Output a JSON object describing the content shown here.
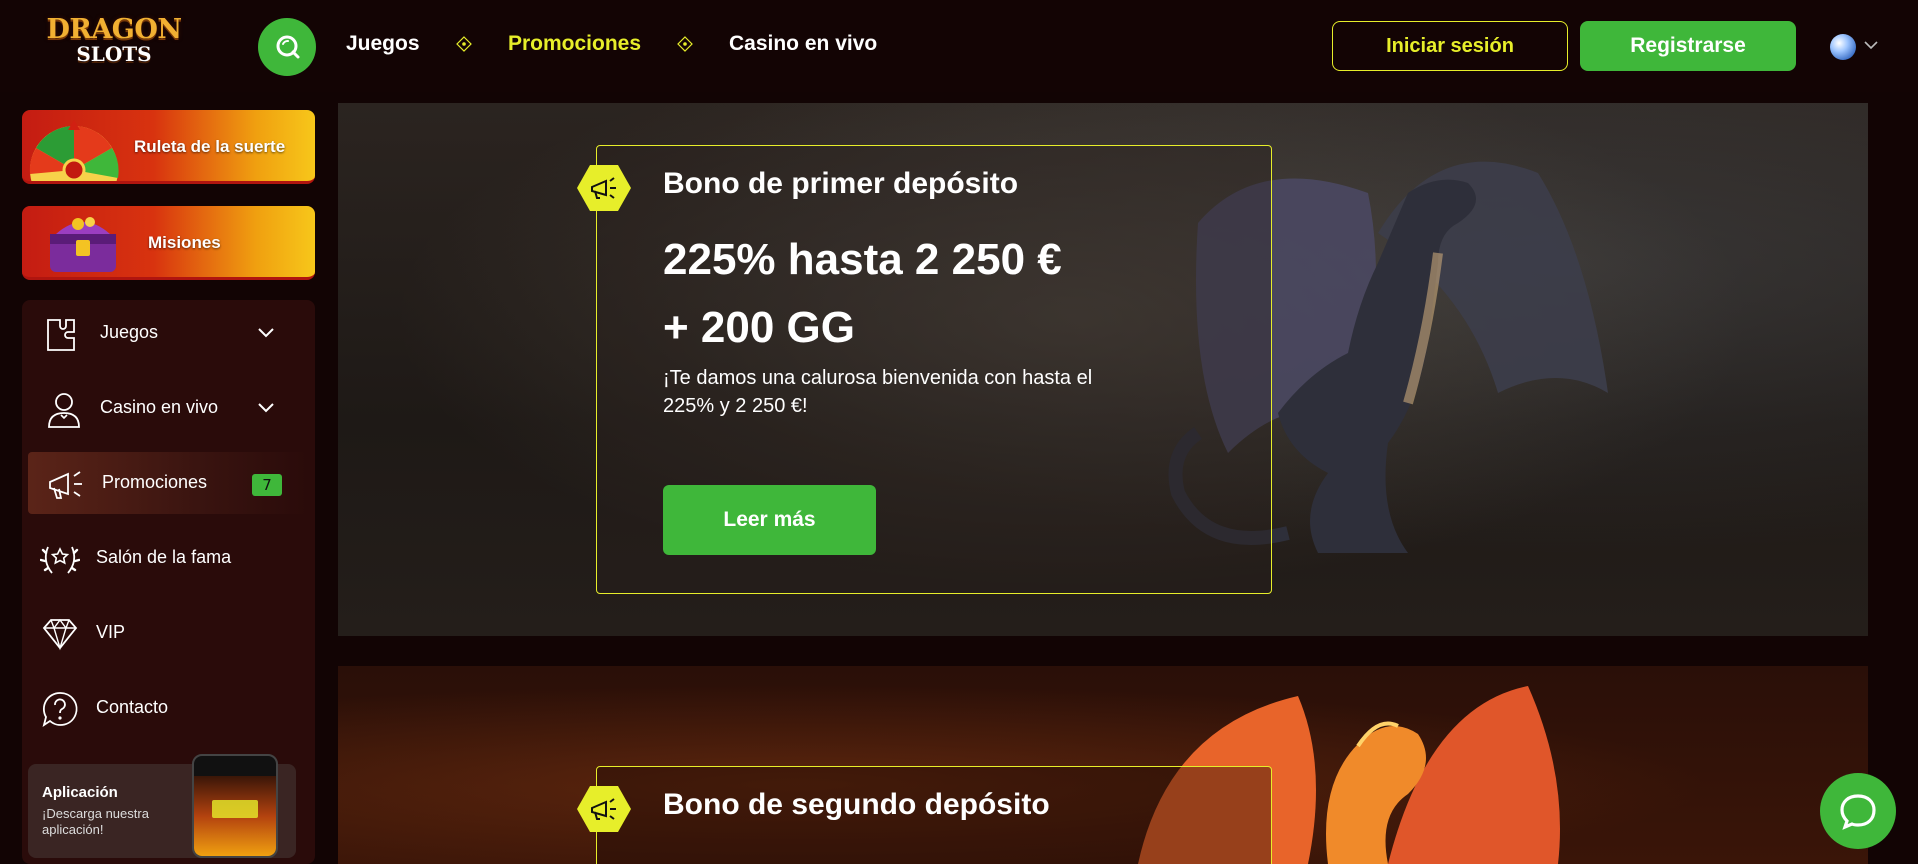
{
  "brand": {
    "logo_top": "DRAGON",
    "logo_bottom": "SLOTS"
  },
  "header": {
    "nav": [
      {
        "label": "Juegos",
        "active": false
      },
      {
        "label": "Promociones",
        "active": true
      },
      {
        "label": "Casino en vivo",
        "active": false
      }
    ],
    "login_label": "Iniciar sesión",
    "register_label": "Registrarse"
  },
  "sidebar": {
    "wheel_label": "Ruleta de la suerte",
    "missions_label": "Misiones",
    "items": [
      {
        "label": "Juegos",
        "icon": "puzzle-icon",
        "expandable": true
      },
      {
        "label": "Casino en vivo",
        "icon": "dealer-icon",
        "expandable": true
      },
      {
        "label": "Promociones",
        "icon": "megaphone-icon",
        "badge": "7",
        "active": true
      },
      {
        "label": "Salón de la fama",
        "icon": "laurel-icon"
      },
      {
        "label": "VIP",
        "icon": "diamond-icon"
      },
      {
        "label": "Contacto",
        "icon": "help-icon"
      }
    ],
    "app": {
      "title": "Aplicación",
      "text": "¡Descarga nuestra aplicación!"
    }
  },
  "promotions": [
    {
      "title": "Bono de primer depósito",
      "amount_line1": "225% hasta 2 250 €",
      "amount_line2": "+ 200 GG",
      "description": "¡Te damos una calurosa bienvenida con hasta el 225% y 2 250 €!",
      "button_label": "Leer más"
    },
    {
      "title": "Bono de segundo depósito"
    }
  ],
  "colors": {
    "accent_yellow": "#e7ee2a",
    "green": "#3fb73a",
    "bg": "#120404"
  }
}
